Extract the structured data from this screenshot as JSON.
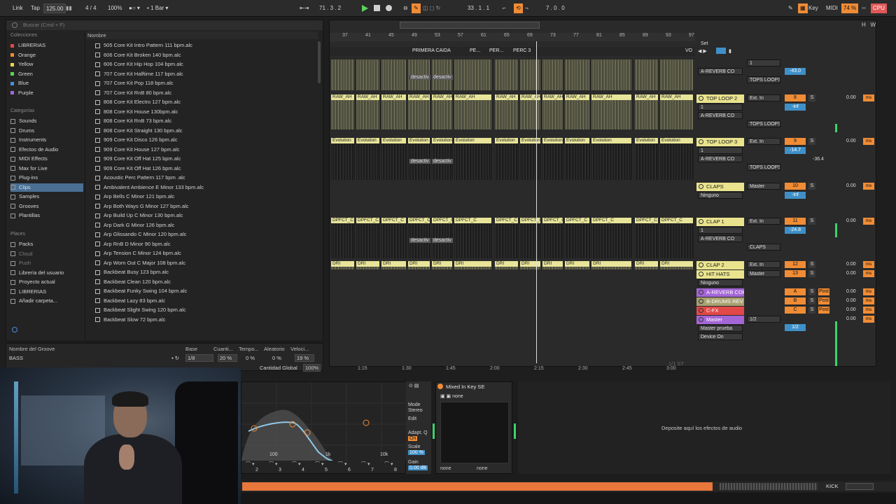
{
  "transport": {
    "link": "Link",
    "tap": "Tap",
    "tempo": "125.00",
    "signature": "4 / 4",
    "zoom": "100%",
    "quantize": "1 Bar",
    "position": "71 .  3 .  2",
    "loop_start": "33 .  1 .  1",
    "loop_length": "7 .  0 .  0",
    "key": "Key",
    "midi": "MIDI",
    "cpu_pct": "74 %",
    "cpu": "CPU"
  },
  "browser": {
    "search_placeholder": "Buscar (Cmd + F)",
    "collections_title": "Colecciones",
    "collections": [
      {
        "label": "LIBRERIAS",
        "color": "#e24848"
      },
      {
        "label": "Orange",
        "color": "#f08c35"
      },
      {
        "label": "Yellow",
        "color": "#e8d64a"
      },
      {
        "label": "Green",
        "color": "#5ad35a"
      },
      {
        "label": "Blue",
        "color": "#4a8de0"
      },
      {
        "label": "Purple",
        "color": "#a466d6"
      }
    ],
    "categories_title": "Categorías",
    "categories": [
      "Sounds",
      "Drums",
      "Instruments",
      "Efectos de Audio",
      "MIDI Effects",
      "Max for Live",
      "Plug-ins",
      "Clips",
      "Samples",
      "Grooves",
      "Plantillas"
    ],
    "selected_category": "Clips",
    "places_title": "Places",
    "places": [
      "Packs",
      "Cloud",
      "Push",
      "Librería del usuario",
      "Proyecto actual",
      "LIBRERIAS",
      "Añadir carpeta..."
    ],
    "column_name": "Nombre",
    "files": [
      "505 Core Kit Intro Pattern 111 bpm.alc",
      "606 Core Kit Broken 140 bpm.alc",
      "606 Core Kit Hip Hop 104 bpm.alc",
      "707 Core Kit Halftime 117 bpm.alc",
      "707 Core Kit Pop 118 bpm.alc",
      "707 Core Kit RnB 80 bpm.alc",
      "808 Core Kit Electro 127 bpm.alc",
      "808 Core Kit House 130bpm.alc",
      "808 Core Kit RnB 73 bpm.alc",
      "808 Core Kit Straight 130 bpm.alc",
      "909 Core Kit Disco 126 bpm.alc",
      "909 Core Kit House 127 bpm.alc",
      "909 Core Kit Off Hat 125 bpm.alc",
      "909 Core Kit Off Hat 126 bpm.alc",
      "Acoustic Perc Pattern 117 bpm .alc",
      "Ambivalent Ambience E Minor 133 bpm.alc",
      "Arp Bells C Minor 121 bpm.alc",
      "Arp Both Ways G Minor 127 bpm.alc",
      "Arp Build Up C Minor 130 bpm.alc",
      "Arp Dark G Minor 126 bpm.alc",
      "Arp Glissando C Minor 120 bpm.alc",
      "Arp RnB D Minor 90 bpm.alc",
      "Arp Tension C Minor 124 bpm.alc",
      "Arp Worn Out C Major 108 bpm.alc",
      "Backbeat Busy 123 bpm.alc",
      "Backbeat Clean 120 bpm.alc",
      "Backbeat Funky Swing 104 bpm.alc",
      "Backbeat Lazy 83 bpm.alc",
      "Backbeat Slight Swing 120 bpm.alc",
      "Backbeat Slow 72 bpm.alc"
    ]
  },
  "groove": {
    "headers": [
      "Nombre del Groove",
      "Base",
      "Cuanti...",
      "Tempo...",
      "Aleatorio",
      "Veloci..."
    ],
    "row": {
      "name": "BASS",
      "base": "1/8",
      "quant": "20 %",
      "tempo": "0 %",
      "random": "0 %",
      "vel": "19 %"
    },
    "global_label": "Cantidad Global",
    "global_value": "100%"
  },
  "arrangement": {
    "bars": [
      "37",
      "41",
      "45",
      "49",
      "53",
      "57",
      "61",
      "65",
      "69",
      "73",
      "77",
      "81",
      "85",
      "89",
      "93",
      "97"
    ],
    "locators": [
      "PRIMERA CAIDA",
      "PE...",
      "PER...",
      "PERC 3",
      "VO"
    ],
    "times": [
      "1:15",
      "1:30",
      "1:45",
      "2:00",
      "2:15",
      "2:30",
      "2:45",
      "3:00"
    ],
    "clip_raw": "RAW_AH",
    "clip_evo": "Evolution",
    "clip_dpfct": "DPFCT_C",
    "clip_dri": "DRI",
    "deactivated": "desactiv",
    "set_label": "Set",
    "page_indicator": "1/1 ST"
  },
  "tracks": [
    {
      "name": "",
      "input": "Mixer",
      "ch": "1",
      "send": "A-REVERB CO",
      "mon": "In  Auto  Off",
      "vol": "-43.0",
      "out": "TOPS LOOPS"
    },
    {
      "name": "TOP LOOP 2",
      "input": "Ext. In",
      "ch": "1",
      "send": "A-REVERB CO",
      "num": "8",
      "vol": "-inf",
      "out": "TOPS LOOPS",
      "pan": "0.00"
    },
    {
      "name": "TOP LOOP 3",
      "input": "Ext. In",
      "ch": "1",
      "send": "A-REVERB CO",
      "num": "9",
      "vol": "-14.7",
      "vol2": "-36.4",
      "out": "TOPS LOOPS",
      "pan": "0.00"
    },
    {
      "name": "CLAPS",
      "input": "Master",
      "ch": "Ninguno",
      "num": "10",
      "vol": "-inf",
      "pan": "0.00"
    },
    {
      "name": "CLAP 1",
      "input": "Ext. In",
      "ch": "1",
      "send": "A-REVERB CO",
      "num": "11",
      "vol": "-24.8",
      "out": "CLAPS",
      "pan": "0.00"
    },
    {
      "name": "CLAP 2",
      "input": "Ext. In",
      "num": "12",
      "pan": "0.00"
    },
    {
      "name": "HIT HATS",
      "input": "Master",
      "ch": "Ninguno",
      "num": "13",
      "pan": "0.00"
    },
    {
      "name": "A-REVERB COR",
      "num": "A",
      "post": "Post",
      "pan": "0.00"
    },
    {
      "name": "B-DRUMS REV",
      "num": "B",
      "post": "Post",
      "pan": "0.00"
    },
    {
      "name": "C-FX",
      "num": "C",
      "post": "Post",
      "pan": "0.00"
    },
    {
      "name": "Master",
      "input": "1/2",
      "ch": "Master prueba",
      "send": "Device On",
      "vol": "1/2",
      "pan": "0.00"
    }
  ],
  "mixer_labels": {
    "solo": "S",
    "cue": "C",
    "ms": "ms",
    "zero": "0",
    "inf": "-inf",
    "in": "In",
    "auto": "Auto",
    "off": "Off"
  },
  "devices": {
    "eq_mode_label": "Mode",
    "eq_mode": "Stereo",
    "eq_edit": "Edit",
    "eq_adapt": "Adapt. Q",
    "eq_adapt_val": "On",
    "eq_scale": "Scale",
    "eq_scale_val": "100 %",
    "eq_gain": "Gain",
    "eq_gain_val": "0.00 dB",
    "eq_freq_100": "100",
    "eq_freq_1k": "1k",
    "eq_freq_10k": "10k",
    "eq_bands": [
      "2",
      "3",
      "4",
      "5",
      "6",
      "7",
      "8"
    ],
    "mik_title": "Mixed In Key SE",
    "mik_none": "none",
    "mik_bottom": [
      "none",
      "none"
    ],
    "drop_text": "Deposite aquí los efectos de audio"
  },
  "status": {
    "kick": "KICK"
  },
  "colors": {
    "accent": "#f08c35",
    "clip": "#e8e59a",
    "track": "#e9e38d",
    "purple": "#a466d6",
    "red": "#e24848"
  }
}
